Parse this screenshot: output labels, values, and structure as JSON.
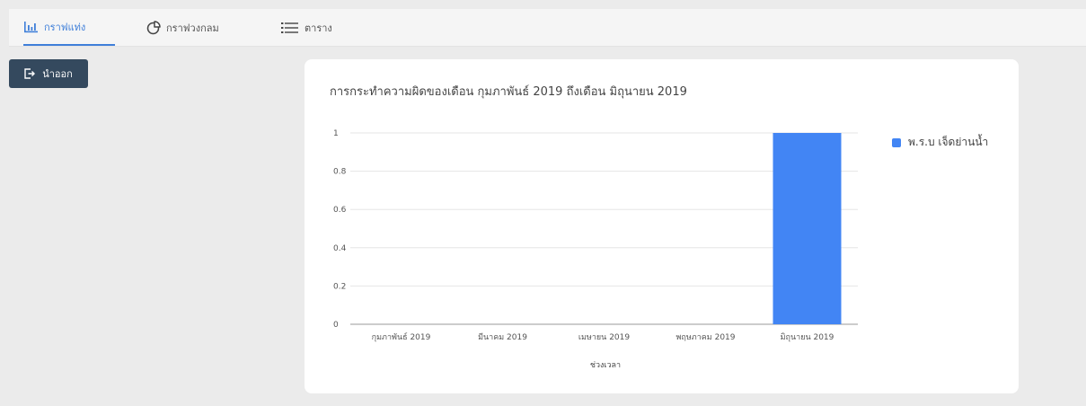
{
  "tabs": [
    {
      "label": "กราฟแท่ง",
      "icon": "bar-chart-icon",
      "active": true
    },
    {
      "label": "กราฟวงกลม",
      "icon": "pie-chart-icon",
      "active": false
    },
    {
      "label": "ตาราง",
      "icon": "list-icon",
      "active": false
    }
  ],
  "toolbar": {
    "export_label": "นำออก",
    "export_icon": "export-icon"
  },
  "colors": {
    "accent": "#3f7fd9",
    "bar": "#4285f4",
    "button": "#34495e"
  },
  "chart_data": {
    "type": "bar",
    "title": "การกระทำความผิดของเดือน กุมภาพันธ์ 2019 ถึงเดือน มิถุนายน 2019",
    "categories": [
      "กุมภาพันธ์ 2019",
      "มีนาคม 2019",
      "เมษายน 2019",
      "พฤษภาคม 2019",
      "มิถุนายน 2019"
    ],
    "series": [
      {
        "name": "พ.ร.บ เจ็ดย่านน้ำ",
        "values": [
          0,
          0,
          0,
          0,
          1
        ]
      }
    ],
    "xlabel": "ช่วงเวลา",
    "ylabel": "",
    "ylim": [
      0,
      1
    ],
    "yticks": [
      "0",
      "0.2",
      "0.4",
      "0.6",
      "0.8",
      "1"
    ],
    "grid": true,
    "legend": "right"
  }
}
